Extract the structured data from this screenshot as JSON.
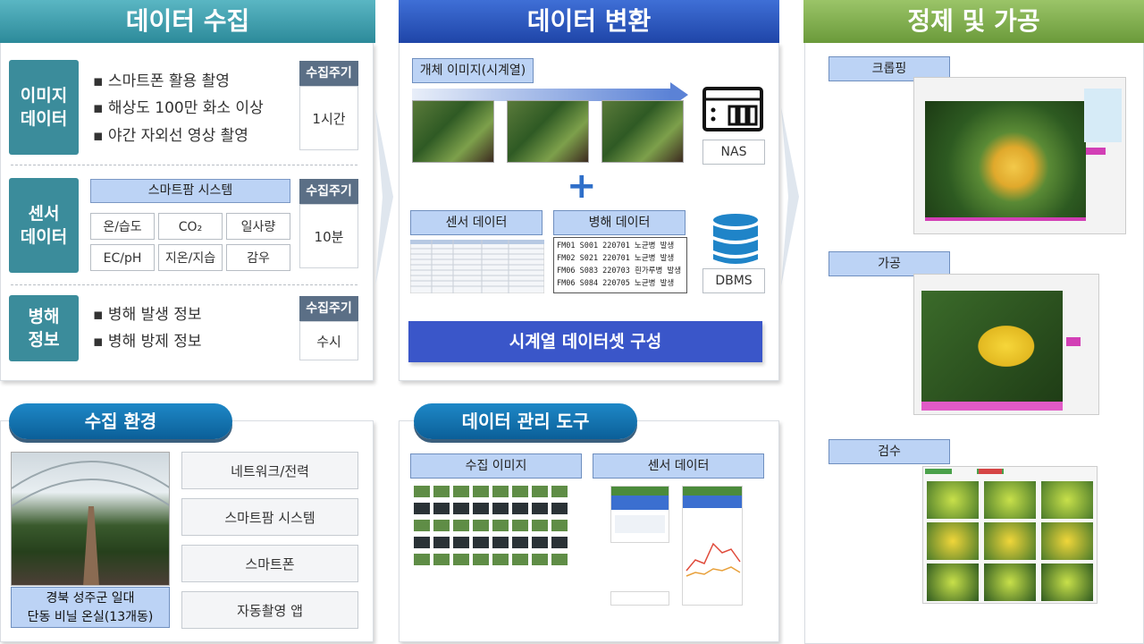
{
  "collection": {
    "header": "데이터 수집",
    "image_data": {
      "category": "이미지\n데이터",
      "bullets": [
        "▪ 스마트폰 활용 촬영",
        "▪ 해상도 100만 화소 이상",
        "▪ 야간 자외선 영상 촬영"
      ],
      "cycle_label": "수집주기",
      "cycle_value": "1시간"
    },
    "sensor_data": {
      "category": "센서\n데이터",
      "system": "스마트팜 시스템",
      "items": [
        "온/습도",
        "CO₂",
        "일사량",
        "EC/pH",
        "지온/지습",
        "감우"
      ],
      "cycle_label": "수집주기",
      "cycle_value": "10분"
    },
    "disease_data": {
      "category": "병해\n정보",
      "bullets": [
        "▪ 병해 발생 정보",
        "▪ 병해 방제 정보"
      ],
      "cycle_label": "수집주기",
      "cycle_value": "수시"
    }
  },
  "conversion": {
    "header": "데이터 변환",
    "image_series_label": "개체 이미지(시계열)",
    "nas_label": "NAS",
    "plus": "+",
    "sensor_label": "센서 데이터",
    "disease_label": "병해 데이터",
    "disease_rows": [
      "FM01 S001 220701 노균병 발생",
      "FM02 S021 220701 노균병 발생",
      "FM06 S083 220703 흰가루병 발생",
      "FM06 S084 220705 노균병 발생"
    ],
    "dbms_label": "DBMS",
    "dataset_button": "시계열 데이터셋 구성"
  },
  "refine": {
    "header": "정제 및 가공",
    "steps": [
      "크롭핑",
      "가공",
      "검수"
    ]
  },
  "environment": {
    "header": "수집 환경",
    "caption": "경북 성주군 일대\n단동 비닐 온실(13개동)",
    "items": [
      "네트워크/전력",
      "스마트팜 시스템",
      "스마트폰",
      "자동촬영 앱"
    ]
  },
  "tools": {
    "header": "데이터 관리 도구",
    "image_label": "수집 이미지",
    "sensor_label": "센서 데이터"
  },
  "colors": {
    "collection_header": "#2c8a9a",
    "conversion_header": "#1f45a8",
    "refine_header": "#6b9a3a",
    "category_box": "#3b8c9b",
    "cycle_header": "#5b6f86",
    "dataset_button": "#3a56c9",
    "pill": "#0b5f98"
  }
}
